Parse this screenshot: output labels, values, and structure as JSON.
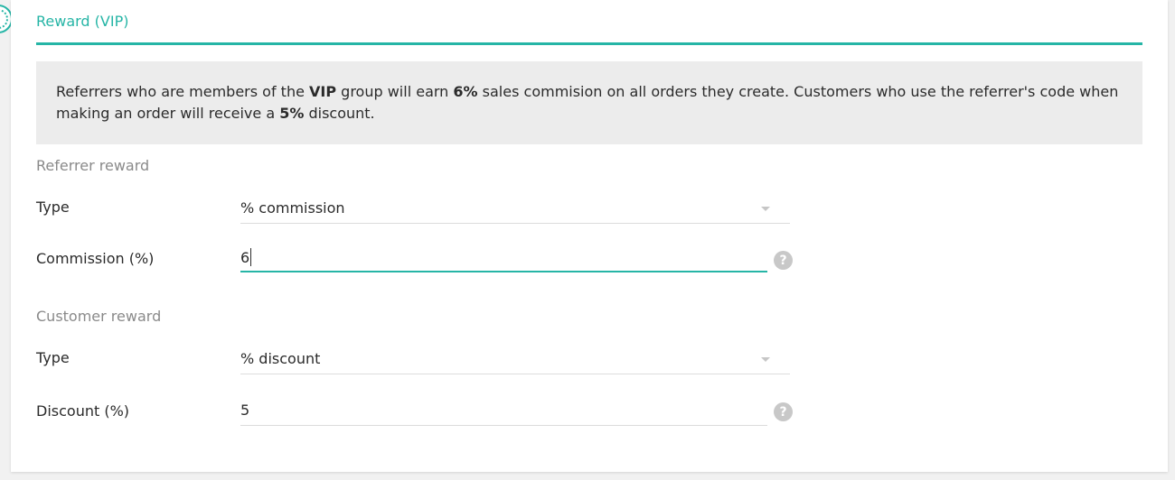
{
  "header": {
    "tab_label": "Reward (VIP)"
  },
  "info": {
    "t1": "Referrers who are members of the ",
    "group": "VIP",
    "t2": " group will earn ",
    "commission": "6%",
    "t3": " sales commision on all orders they create. Customers who use the referrer's code when making an order will receive a ",
    "discount": "5%",
    "t4": " discount."
  },
  "referrer": {
    "section_label": "Referrer reward",
    "type_label": "Type",
    "type_value": "% commission",
    "commission_label": "Commission (%)",
    "commission_value": "6"
  },
  "customer": {
    "section_label": "Customer reward",
    "type_label": "Type",
    "type_value": "% discount",
    "discount_label": "Discount (%)",
    "discount_value": "5"
  },
  "help_glyph": "?",
  "icons": {
    "help": "question-circle-icon",
    "dropdown": "caret-down-icon"
  },
  "colors": {
    "accent": "#26b5a6",
    "info_bg": "#ececec"
  }
}
